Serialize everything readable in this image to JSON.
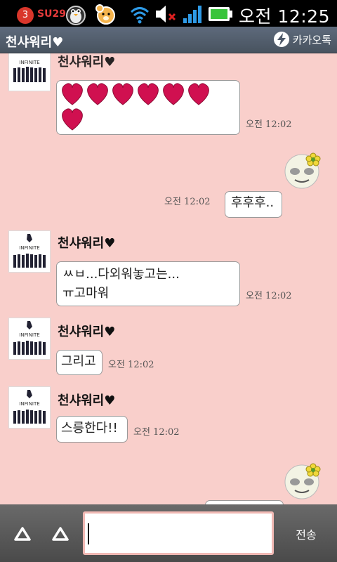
{
  "status_bar": {
    "notification_count": "3",
    "carrier_icon_label": "SU29",
    "time": "오전 12:25",
    "icons": [
      "notification-badge-icon",
      "penguin-app-icon",
      "bear-app-icon",
      "wifi-icon",
      "mute-icon",
      "signal-icon",
      "battery-icon"
    ]
  },
  "header": {
    "title": "천샤워리♥",
    "app_name": "카카오톡",
    "app_icon": "kakaotalk-icon"
  },
  "messages": [
    {
      "sender": "천샤워리♥",
      "content": "heart-emoticons",
      "time": "오전 12:02"
    },
    {
      "sender": "me",
      "text": "후후후..",
      "time": "오전 12:02"
    },
    {
      "sender": "천샤워리♥",
      "text_line1": "ㅆㅂ...다외워놓고는...",
      "text_line2": "ㅠ고마워",
      "time": "오전 12:02"
    },
    {
      "sender": "천샤워리♥",
      "text": "그리고",
      "time": "오전 12:02"
    },
    {
      "sender": "천샤워리♥",
      "text": "스릉한다!!",
      "time": "오전 12:02"
    }
  ],
  "input_bar": {
    "left_button_icon": "up-triangle-icon",
    "second_button_icon": "up-triangle-icon",
    "message_value": "",
    "send_label": "전송"
  },
  "colors": {
    "chat_background": "#f9cfcb",
    "heart": "#d01050",
    "input_border": "#f1b9b4"
  }
}
